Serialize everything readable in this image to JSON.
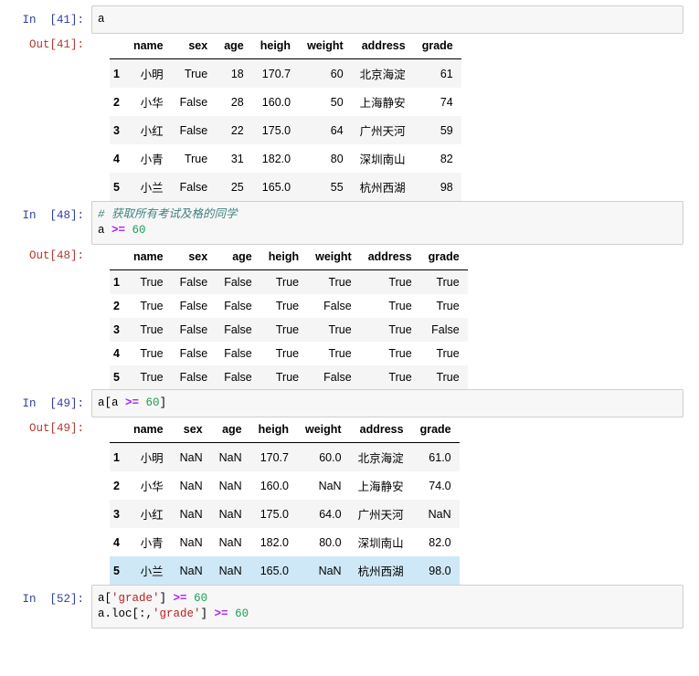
{
  "notebook": {
    "cells": [
      {
        "type": "code",
        "in_prompt": "In  [41]:",
        "out_prompt": "Out[41]:",
        "source_lines": [
          [
            {
              "t": "plain",
              "s": "a"
            }
          ]
        ],
        "table": {
          "index_header": "",
          "columns": [
            "name",
            "sex",
            "age",
            "heigh",
            "weight",
            "address",
            "grade"
          ],
          "index": [
            "1",
            "2",
            "3",
            "4",
            "5"
          ],
          "rows": [
            [
              "小明",
              "True",
              "18",
              "170.7",
              "60",
              "北京海淀",
              "61"
            ],
            [
              "小华",
              "False",
              "28",
              "160.0",
              "50",
              "上海静安",
              "74"
            ],
            [
              "小红",
              "False",
              "22",
              "175.0",
              "64",
              "广州天河",
              "59"
            ],
            [
              "小青",
              "True",
              "31",
              "182.0",
              "80",
              "深圳南山",
              "82"
            ],
            [
              "小兰",
              "False",
              "25",
              "165.0",
              "55",
              "杭州西湖",
              "98"
            ]
          ],
          "highlight_row": -1
        }
      },
      {
        "type": "code",
        "in_prompt": "In  [48]:",
        "out_prompt": "Out[48]:",
        "source_lines": [
          [
            {
              "t": "comment",
              "s": "# 获取所有考试及格的同学"
            }
          ],
          [
            {
              "t": "plain",
              "s": "a "
            },
            {
              "t": "op",
              "s": ">="
            },
            {
              "t": "plain",
              "s": " "
            },
            {
              "t": "num",
              "s": "60"
            }
          ]
        ],
        "table": {
          "index_header": "",
          "columns": [
            "name",
            "sex",
            "age",
            "heigh",
            "weight",
            "address",
            "grade"
          ],
          "index": [
            "1",
            "2",
            "3",
            "4",
            "5"
          ],
          "rows": [
            [
              "True",
              "False",
              "False",
              "True",
              "True",
              "True",
              "True"
            ],
            [
              "True",
              "False",
              "False",
              "True",
              "False",
              "True",
              "True"
            ],
            [
              "True",
              "False",
              "False",
              "True",
              "True",
              "True",
              "False"
            ],
            [
              "True",
              "False",
              "False",
              "True",
              "True",
              "True",
              "True"
            ],
            [
              "True",
              "False",
              "False",
              "True",
              "False",
              "True",
              "True"
            ]
          ],
          "highlight_row": -1
        }
      },
      {
        "type": "code",
        "in_prompt": "In  [49]:",
        "out_prompt": "Out[49]:",
        "source_lines": [
          [
            {
              "t": "plain",
              "s": "a[a "
            },
            {
              "t": "op",
              "s": ">="
            },
            {
              "t": "plain",
              "s": " "
            },
            {
              "t": "num",
              "s": "60"
            },
            {
              "t": "plain",
              "s": "]"
            }
          ]
        ],
        "table": {
          "index_header": "",
          "columns": [
            "name",
            "sex",
            "age",
            "heigh",
            "weight",
            "address",
            "grade"
          ],
          "index": [
            "1",
            "2",
            "3",
            "4",
            "5"
          ],
          "rows": [
            [
              "小明",
              "NaN",
              "NaN",
              "170.7",
              "60.0",
              "北京海淀",
              "61.0"
            ],
            [
              "小华",
              "NaN",
              "NaN",
              "160.0",
              "NaN",
              "上海静安",
              "74.0"
            ],
            [
              "小红",
              "NaN",
              "NaN",
              "175.0",
              "64.0",
              "广州天河",
              "NaN"
            ],
            [
              "小青",
              "NaN",
              "NaN",
              "182.0",
              "80.0",
              "深圳南山",
              "82.0"
            ],
            [
              "小兰",
              "NaN",
              "NaN",
              "165.0",
              "NaN",
              "杭州西湖",
              "98.0"
            ]
          ],
          "highlight_row": 4
        }
      },
      {
        "type": "code",
        "in_prompt": "In  [52]:",
        "out_prompt": "",
        "source_lines": [
          [
            {
              "t": "plain",
              "s": "a["
            },
            {
              "t": "str",
              "s": "'grade'"
            },
            {
              "t": "plain",
              "s": "] "
            },
            {
              "t": "op",
              "s": ">="
            },
            {
              "t": "plain",
              "s": " "
            },
            {
              "t": "num",
              "s": "60"
            }
          ],
          [
            {
              "t": "plain",
              "s": "a.loc[:,"
            },
            {
              "t": "str",
              "s": "'grade'"
            },
            {
              "t": "plain",
              "s": "] "
            },
            {
              "t": "op",
              "s": ">="
            },
            {
              "t": "plain",
              "s": " "
            },
            {
              "t": "num",
              "s": "60"
            }
          ]
        ],
        "table": null
      }
    ]
  },
  "colors": {
    "in_prompt": "#303f9f",
    "out_prompt": "#b03a2e",
    "code_bg": "#f7f7f7",
    "code_border": "#cfcfcf",
    "stripe": "#f5f5f5",
    "highlight": "#cfe8f7",
    "comment": "#408080",
    "operator": "#aa22ff",
    "number": "#1a9e57",
    "string": "#ba2121"
  }
}
